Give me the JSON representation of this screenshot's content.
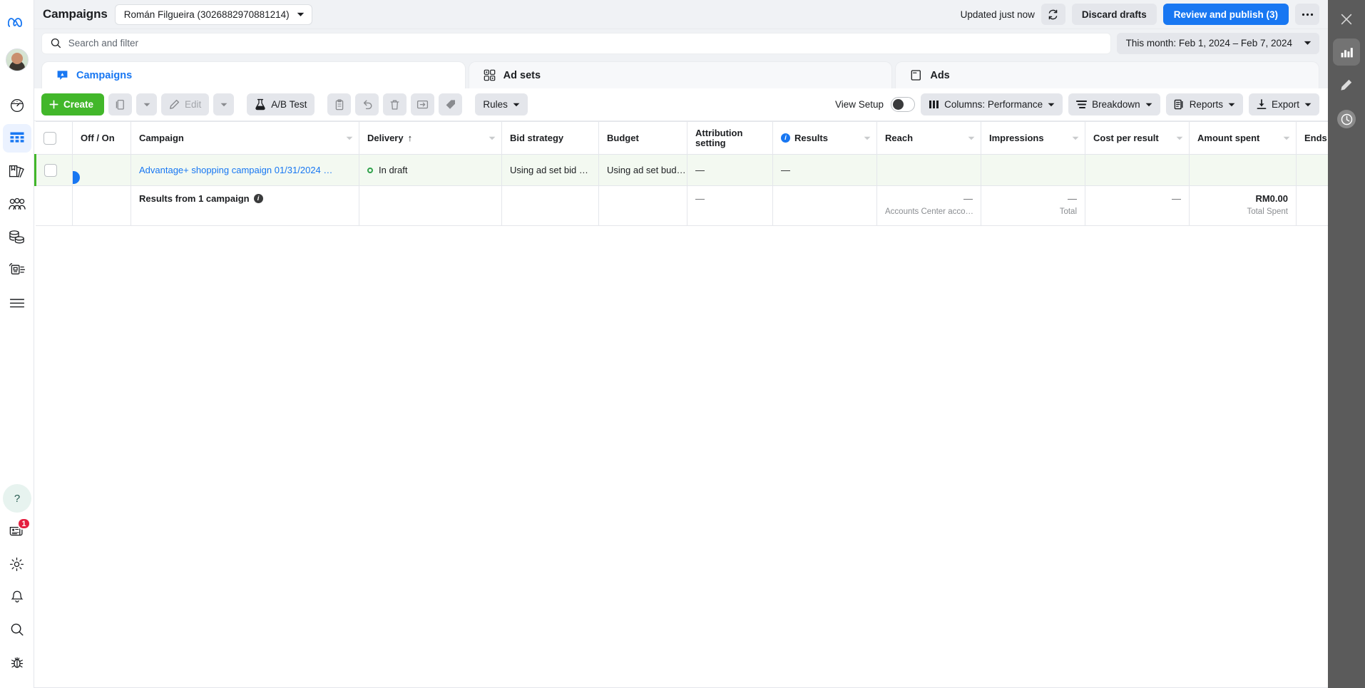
{
  "topbar": {
    "page_title": "Campaigns",
    "account_selector": "Román Filgueira (3026882970881214)",
    "updated_status": "Updated just now",
    "refresh_icon": "refresh-icon",
    "discard_label": "Discard drafts",
    "publish_label": "Review and publish (3)",
    "more_label": "•••",
    "close_icon": "close-icon"
  },
  "search": {
    "placeholder": "Search and filter",
    "value": "",
    "icon": "search-icon",
    "date_range": "This month: Feb 1, 2024 – Feb 7, 2024"
  },
  "tabs": [
    {
      "label": "Campaigns",
      "icon": "campaign-flag-icon",
      "active": true
    },
    {
      "label": "Ad sets",
      "icon": "adsets-grid-icon",
      "active": false
    },
    {
      "label": "Ads",
      "icon": "ads-card-icon",
      "active": false
    }
  ],
  "toolbar": {
    "create_label": "Create",
    "duplicate_icon": "duplicate-icon",
    "duplicate_caret_icon": "chevron-down-icon",
    "edit_label": "Edit",
    "edit_icon": "pencil-icon",
    "edit_caret_icon": "chevron-down-icon",
    "ab_test_label": "A/B Test",
    "ab_test_icon": "flask-icon",
    "clipboard_icon": "clipboard-icon",
    "undo_icon": "undo-icon",
    "delete_icon": "trash-icon",
    "export_row_icon": "export-arrow-icon",
    "tag_icon": "tag-icon",
    "rules_label": "Rules",
    "view_setup_label": "View Setup",
    "view_setup_on": false,
    "columns_label": "Columns: Performance",
    "columns_icon": "columns-icon",
    "breakdown_label": "Breakdown",
    "breakdown_icon": "breakdown-icon",
    "reports_label": "Reports",
    "reports_icon": "reports-icon",
    "export_label": "Export",
    "export_icon": "download-icon"
  },
  "table": {
    "columns": [
      {
        "key": "select",
        "label": "",
        "sortable": false
      },
      {
        "key": "offon",
        "label": "Off / On",
        "sortable": false
      },
      {
        "key": "campaign",
        "label": "Campaign",
        "sortable": true
      },
      {
        "key": "delivery",
        "label": "Delivery",
        "sortable": true,
        "sorted": "asc",
        "sort_glyph": "↑"
      },
      {
        "key": "bid",
        "label": "Bid strategy",
        "sortable": false
      },
      {
        "key": "budget",
        "label": "Budget",
        "sortable": false
      },
      {
        "key": "attribution",
        "label": "Attribution setting",
        "sortable": false
      },
      {
        "key": "results",
        "label": "Results",
        "sortable": true,
        "info": true
      },
      {
        "key": "reach",
        "label": "Reach",
        "sortable": true
      },
      {
        "key": "impressions",
        "label": "Impressions",
        "sortable": true
      },
      {
        "key": "cpr",
        "label": "Cost per result",
        "sortable": true
      },
      {
        "key": "amount",
        "label": "Amount spent",
        "sortable": true
      },
      {
        "key": "ends",
        "label": "Ends",
        "sortable": false
      }
    ],
    "rows": [
      {
        "checked": false,
        "toggle_on": true,
        "campaign": "Advantage+ shopping campaign 01/31/2024 …",
        "delivery": "In draft",
        "delivery_status_color": "#31a24c",
        "bid": "Using ad set bid …",
        "budget": "Using ad set bud…",
        "attribution": "—",
        "results": "—",
        "reach": "",
        "impressions": "",
        "cpr": "",
        "amount": "",
        "ends": ""
      }
    ],
    "totals": {
      "label": "Results from 1 campaign",
      "attribution": "—",
      "results": "",
      "reach_value": "—",
      "reach_sub": "Accounts Center acco…",
      "impressions_value": "—",
      "impressions_sub": "Total",
      "cpr_value": "—",
      "cpr_sub": "",
      "amount_value": "RM0.00",
      "amount_sub": "Total Spent"
    }
  },
  "left_rail": {
    "items": [
      {
        "name": "meta-logo-icon",
        "active": false
      },
      {
        "name": "avatar",
        "active": false
      },
      {
        "name": "overview-dial-icon",
        "active": false
      },
      {
        "name": "campaigns-table-icon",
        "active": true
      },
      {
        "name": "library-icon",
        "active": false
      },
      {
        "name": "audiences-icon",
        "active": false
      },
      {
        "name": "billing-coins-icon",
        "active": false
      },
      {
        "name": "catalog-icon",
        "active": false
      },
      {
        "name": "all-tools-icon",
        "active": false
      },
      {
        "name": "help-icon",
        "active": false
      },
      {
        "name": "news-icon",
        "active": false,
        "badge": "1"
      },
      {
        "name": "gear-icon",
        "active": false
      },
      {
        "name": "bell-icon",
        "active": false
      },
      {
        "name": "search-icon",
        "active": false
      },
      {
        "name": "bug-icon",
        "active": false
      }
    ],
    "news_badge": "1"
  },
  "right_rail": {
    "items": [
      {
        "name": "close-icon",
        "selected": false
      },
      {
        "name": "chart-bars-icon",
        "selected": true
      },
      {
        "name": "pencil-icon",
        "selected": false
      },
      {
        "name": "clock-icon",
        "selected": false
      }
    ]
  },
  "colors": {
    "brand_blue": "#1877f2",
    "create_green": "#42b72a",
    "chrome_gray": "#f0f2f5",
    "row_green_tint": "#f3f9f1",
    "status_green": "#31a24c"
  }
}
